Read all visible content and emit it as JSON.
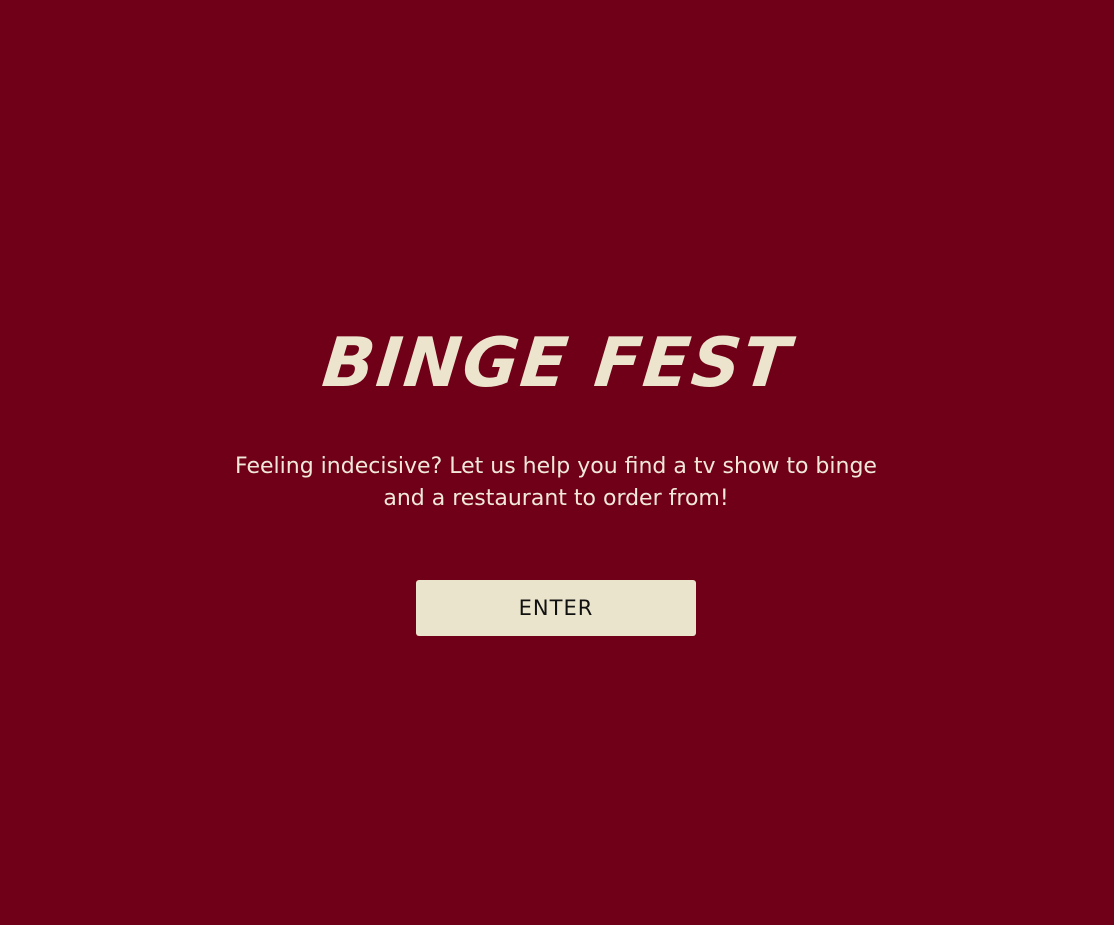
{
  "landing": {
    "title": "BINGE FEST",
    "tagline": "Feeling indecisive? Let us help you find a tv show to binge and a restaurant to order from!",
    "enter_label": "ENTER"
  },
  "colors": {
    "background": "#700017",
    "title": "#ece4cc",
    "text": "#f1e8da",
    "button_background": "#ebe4cc",
    "button_text": "#111111"
  }
}
